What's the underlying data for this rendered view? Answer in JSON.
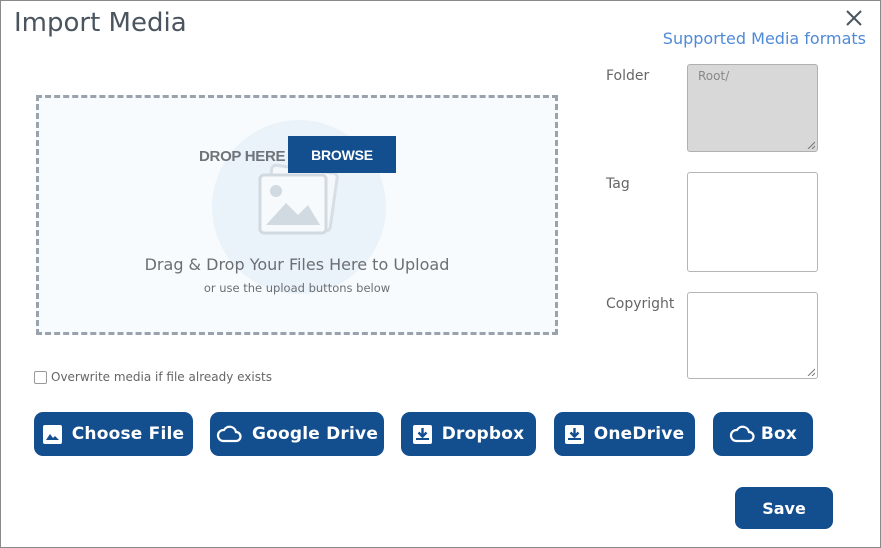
{
  "dialog": {
    "title": "Import Media",
    "supported_formats_link": "Supported Media formats"
  },
  "dropzone": {
    "drop_here": "DROP HERE",
    "browse_label": "BROWSE",
    "drag_text": "Drag & Drop Your Files Here to Upload",
    "sub_text": "or use the upload buttons below"
  },
  "overwrite": {
    "label": "Overwrite media if file already exists",
    "checked": false
  },
  "fields": {
    "folder": {
      "label": "Folder",
      "value": "Root/"
    },
    "tag": {
      "label": "Tag",
      "value": ""
    },
    "copyright": {
      "label": "Copyright",
      "value": ""
    }
  },
  "sources": {
    "choose_file": "Choose File",
    "google_drive": "Google Drive",
    "dropbox": "Dropbox",
    "onedrive": "OneDrive",
    "box": "Box"
  },
  "actions": {
    "save_label": "Save"
  },
  "colors": {
    "primary": "#134e8f",
    "link": "#4f8ad6",
    "disabled_field": "#d8d8d8"
  },
  "icons": {
    "close": "close-icon",
    "drop_image": "image-placeholder-icon",
    "choose_file": "image-icon",
    "google_drive": "cloud-icon",
    "dropbox": "download-box-icon",
    "onedrive": "download-box-icon",
    "box": "cloud-icon"
  }
}
